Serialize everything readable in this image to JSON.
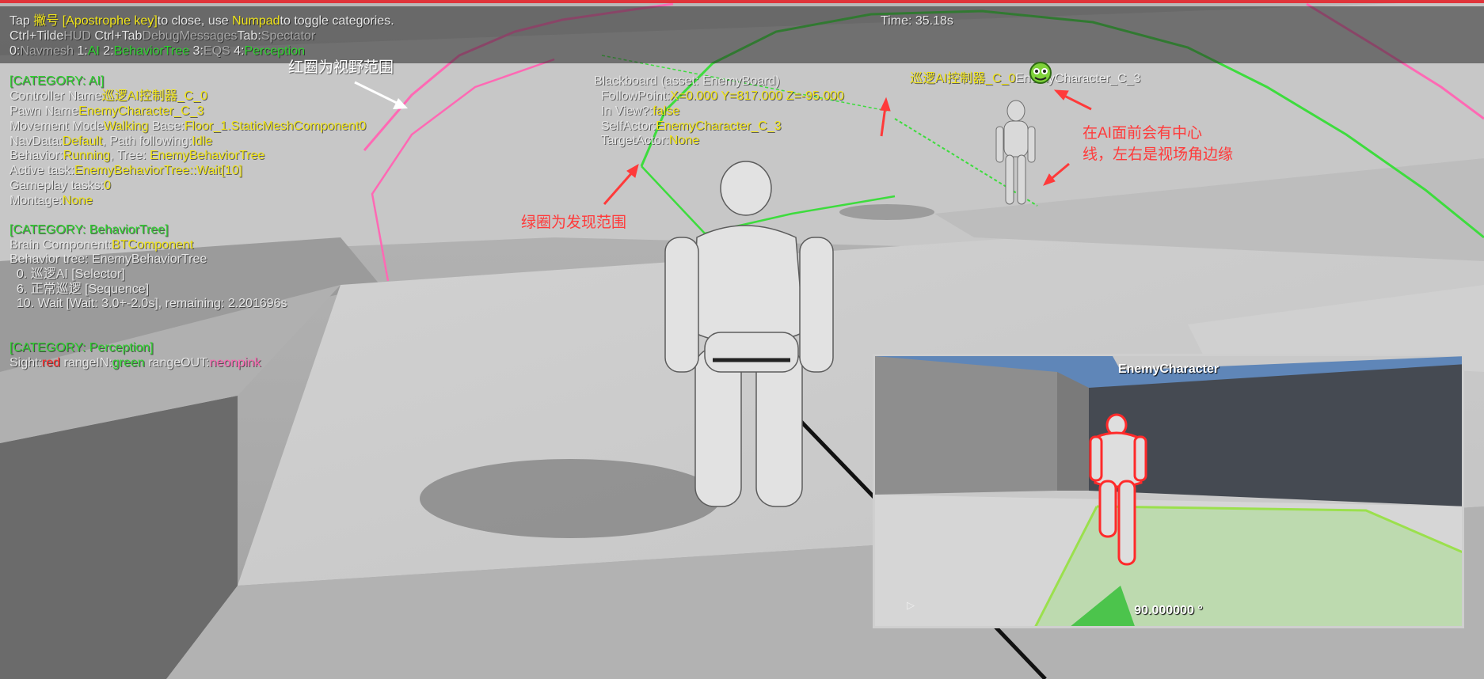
{
  "hud": {
    "line1": {
      "tap": "Tap ",
      "key": "撇号 [Apostrophe key]",
      "close": "to close, use ",
      "numpad": "Numpad",
      "toggle": "to toggle categories."
    },
    "timer": "Time: 35.18s",
    "line2": {
      "ctrl_tilde": "Ctrl+Tilde",
      "hud": "HUD",
      "ctrl_tab": " Ctrl+Tab",
      "debug": "DebugMessages",
      "tab": "Tab:",
      "spectator": "Spectator"
    },
    "line3": {
      "c0": "0:",
      "navmesh": "Navmesh",
      "c1": " 1:",
      "ai": "AI",
      "c2": " 2:",
      "bt": "BehaviorTree",
      "c3": " 3:",
      "eqs": "EQS",
      "c4": " 4:",
      "perception": "Perception"
    }
  },
  "category_ai": {
    "header": "[CATEGORY: AI]",
    "controller_label": "Controller Name",
    "controller_value": "巡逻AI控制器_C_0",
    "pawn_label": "Pawn Name",
    "pawn_value": "EnemyCharacter_C_3",
    "movement_label": "Movement Mode",
    "movement_value": "Walking",
    "base_label": " Base:",
    "base_value": "Floor_1.StaticMeshComponent0",
    "navdata_label": "NavData:",
    "navdata_value": "Default",
    "path_label": ", Path following:",
    "path_value": "Idle",
    "behavior_label": "Behavior:",
    "behavior_value": "Running",
    "tree_label": ", Tree: ",
    "tree_value": "EnemyBehaviorTree",
    "task_label": "Active task:",
    "task_value": "EnemyBehaviorTree::Wait[10]",
    "gameplay_label": "Gameplay tasks:",
    "gameplay_value": "0",
    "montage_label": "Montage:",
    "montage_value": "None"
  },
  "category_bt": {
    "header": "[CATEGORY: BehaviorTree]",
    "brain_label": "Brain Component:",
    "brain_value": "BTComponent",
    "tree_line": "Behavior tree: EnemyBehaviorTree",
    "nodes": [
      "  0. 巡逻AI [Selector]",
      "  6. 正常巡逻 [Sequence]",
      "  10. Wait [Wait: 3.0+-2.0s], remaining: 2.201696s"
    ]
  },
  "category_perception": {
    "header": "[CATEGORY: Perception]",
    "sight": "Sight:",
    "red": "red",
    "range_in": " rangeIN:",
    "green": "green",
    "range_out": " rangeOUT:",
    "neonpink": "neonpink"
  },
  "blackboard": {
    "title": "Blackboard (asset: EnemyBoard)",
    "follow_label": "  FollowPoint:",
    "follow_value": "X=0.000 Y=817.000 Z=-95.000",
    "inview_label": "  In View?:",
    "inview_value": "false",
    "self_label": "  SelfActor:",
    "self_value": "EnemyCharacter_C_3",
    "target_label": "  TargetActor:",
    "target_value": "None"
  },
  "ai_tag": {
    "controller": "巡逻AI控制器_C_0",
    "character": "EnemyCharacter_C_3"
  },
  "annotations": {
    "view_range": "红圈为视野范围",
    "detect_range": "绿圈为发现范围",
    "centerline_1": "在AI面前会有中心",
    "centerline_2": "线，左右是视场角边缘"
  },
  "pip": {
    "title": "EnemyCharacter",
    "fov": "90.000000 °"
  },
  "colors": {
    "hud_yellow": "#f1e51a",
    "hud_green": "#2fd42f",
    "sight_pink": "#ff69b4",
    "detect_green": "#3ddc3d",
    "annotation_red": "#ff3a3a",
    "outline_red": "#ff2a2a"
  }
}
